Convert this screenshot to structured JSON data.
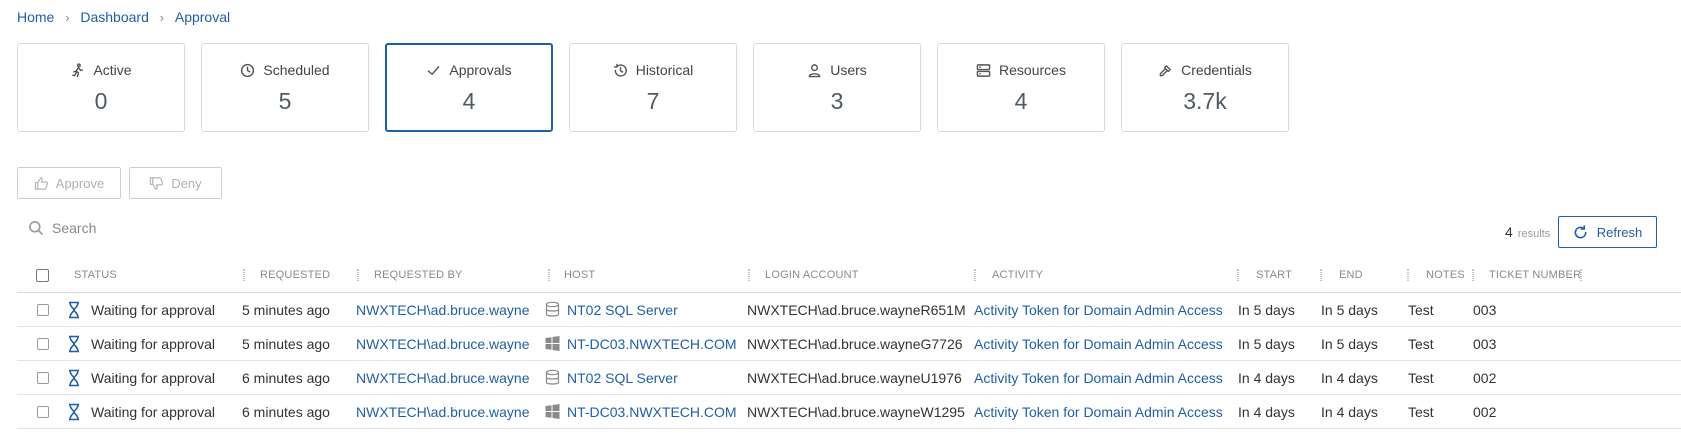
{
  "breadcrumb": {
    "home": "Home",
    "dashboard": "Dashboard",
    "approval": "Approval"
  },
  "cards": [
    {
      "icon": "running-person-icon",
      "label": "Active",
      "value": "0"
    },
    {
      "icon": "clock-icon",
      "label": "Scheduled",
      "value": "5"
    },
    {
      "icon": "checkmark-icon",
      "label": "Approvals",
      "value": "4"
    },
    {
      "icon": "history-icon",
      "label": "Historical",
      "value": "7"
    },
    {
      "icon": "user-icon",
      "label": "Users",
      "value": "3"
    },
    {
      "icon": "server-icon",
      "label": "Resources",
      "value": "4"
    },
    {
      "icon": "key-icon",
      "label": "Credentials",
      "value": "3.7k"
    }
  ],
  "actions": {
    "approve_label": "Approve",
    "deny_label": "Deny"
  },
  "search": {
    "placeholder": "Search",
    "value": ""
  },
  "results": {
    "count": "4",
    "label": "results"
  },
  "refresh_label": "Refresh",
  "columns": {
    "status": "STATUS",
    "requested": "REQUESTED",
    "requested_by": "REQUESTED BY",
    "host": "HOST",
    "login_account": "LOGIN ACCOUNT",
    "activity": "ACTIVITY",
    "start": "START",
    "end": "END",
    "notes": "NOTES",
    "ticket_number": "TICKET NUMBER"
  },
  "rows": [
    {
      "status": "Waiting for approval",
      "requested": "5 minutes ago",
      "requested_by": "NWXTECH\\ad.bruce.wayne",
      "host_icon": "database-icon",
      "host": "NT02 SQL Server",
      "login_account": "NWXTECH\\ad.bruce.wayneR651M",
      "activity": "Activity Token for Domain Admin Access",
      "start": "In 5 days",
      "end": "In 5 days",
      "notes": "Test",
      "ticket": "003"
    },
    {
      "status": "Waiting for approval",
      "requested": "5 minutes ago",
      "requested_by": "NWXTECH\\ad.bruce.wayne",
      "host_icon": "windows-icon",
      "host": "NT-DC03.NWXTECH.COM",
      "login_account": "NWXTECH\\ad.bruce.wayneG7726",
      "activity": "Activity Token for Domain Admin Access",
      "start": "In 5 days",
      "end": "In 5 days",
      "notes": "Test",
      "ticket": "003"
    },
    {
      "status": "Waiting for approval",
      "requested": "6 minutes ago",
      "requested_by": "NWXTECH\\ad.bruce.wayne",
      "host_icon": "database-icon",
      "host": "NT02 SQL Server",
      "login_account": "NWXTECH\\ad.bruce.wayneU1976",
      "activity": "Activity Token for Domain Admin Access",
      "start": "In 4 days",
      "end": "In 4 days",
      "notes": "Test",
      "ticket": "002"
    },
    {
      "status": "Waiting for approval",
      "requested": "6 minutes ago",
      "requested_by": "NWXTECH\\ad.bruce.wayne",
      "host_icon": "windows-icon",
      "host": "NT-DC03.NWXTECH.COM",
      "login_account": "NWXTECH\\ad.bruce.wayneW1295",
      "activity": "Activity Token for Domain Admin Access",
      "start": "In 4 days",
      "end": "In 4 days",
      "notes": "Test",
      "ticket": "002"
    }
  ],
  "colors": {
    "accent": "#1f5fa8",
    "border": "#d9d9d9",
    "text": "#333333"
  }
}
